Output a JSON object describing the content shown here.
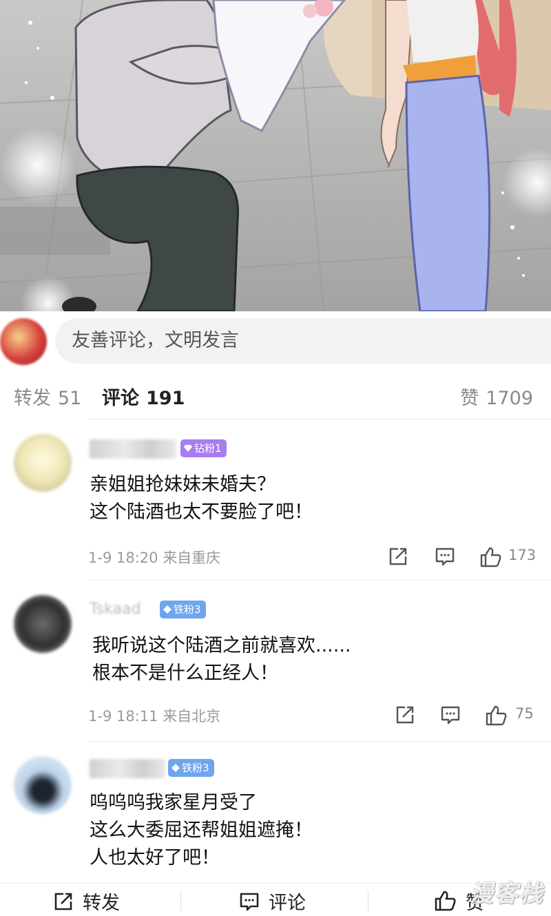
{
  "composer": {
    "placeholder": "友善评论，文明发言"
  },
  "tabs": {
    "repost_label": "转发",
    "repost_count": "51",
    "comment_label": "评论",
    "comment_count": "191",
    "like_label": "赞",
    "like_count": "1709"
  },
  "comments": [
    {
      "username": "",
      "badge": "钻粉1",
      "badge_color": "#a77df0",
      "lines": [
        "亲姐姐抢妹妹未婚夫？",
        "这个陆酒也太不要脸了吧！"
      ],
      "time": "1-9 18:20",
      "location": "来自重庆",
      "likes": "173"
    },
    {
      "username": "Tskaad",
      "badge": "铁粉3",
      "badge_color": "#6ea6ee",
      "lines": [
        "我听说这个陆酒之前就喜欢......",
        "根本不是什么正经人！"
      ],
      "time": "1-9 18:11",
      "location": "来自北京",
      "likes": "75"
    },
    {
      "username": "",
      "badge": "铁粉3",
      "badge_color": "#6ea6ee",
      "lines": [
        "呜呜呜我家星月受了",
        "这么大委屈还帮姐姐遮掩！",
        "人也太好了吧！"
      ]
    }
  ],
  "bottombar": {
    "repost": "转发",
    "comment": "评论",
    "like": "赞"
  },
  "watermark": "漫客栈",
  "icons": {
    "share": "share-icon",
    "reply": "comment-bubble-icon",
    "like": "thumbs-up-icon"
  }
}
